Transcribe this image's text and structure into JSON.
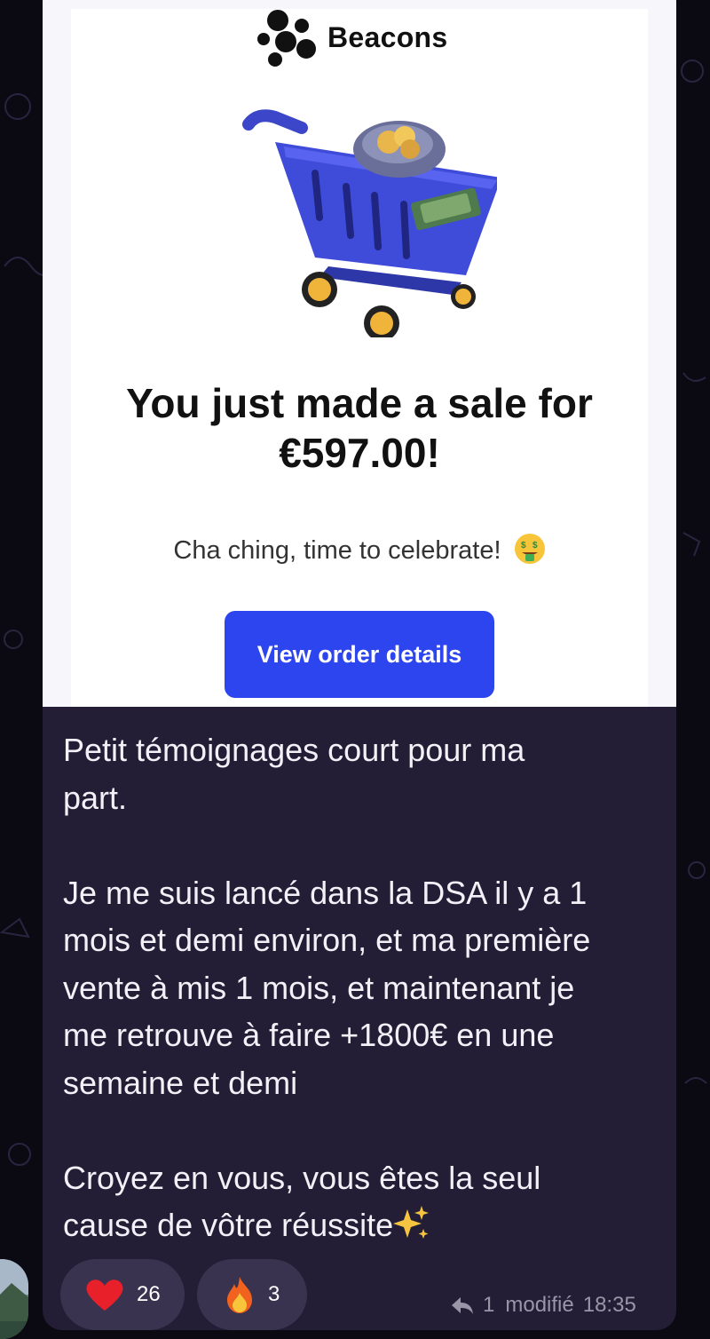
{
  "email": {
    "brand_name": "Beacons",
    "headline_line1": "You just made a sale for",
    "headline_line2": "€597.00!",
    "subline": "Cha ching, time to celebrate!",
    "cta_label": "View order details"
  },
  "message": {
    "text": "Petit témoignages court pour ma\npart.\n\nJe me suis lancé dans la DSA il y a 1\nmois et demi environ, et ma première\nvente à mis 1 mois, et maintenant je\nme retrouve à faire +1800€ en une\nsemaine et demi\n\nCroyez en vous, vous êtes la seul\ncause de vôtre réussite"
  },
  "reactions": [
    {
      "emoji": "heart",
      "count": "26"
    },
    {
      "emoji": "fire",
      "count": "3"
    }
  ],
  "meta": {
    "reply_count": "1",
    "edited_label": "modifié",
    "time": "18:35"
  },
  "colors": {
    "cta_bg": "#2d45ee",
    "bubble_bg": "#231d35",
    "reaction_bg": "#3a3350",
    "heart": "#e8202a"
  }
}
